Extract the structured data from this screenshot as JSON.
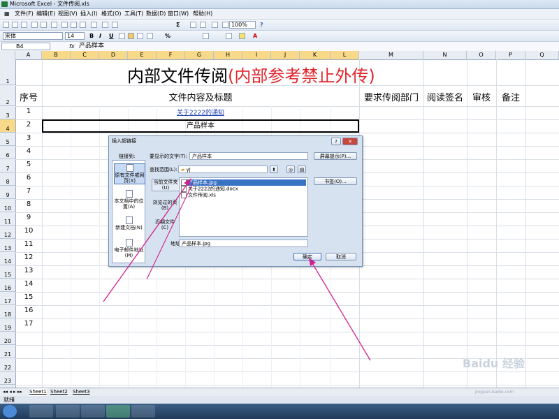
{
  "window": {
    "title": "Microsoft Excel - 文件传阅.xls"
  },
  "menu": [
    "文件(F)",
    "编辑(E)",
    "视图(V)",
    "插入(I)",
    "格式(O)",
    "工具(T)",
    "数据(D)",
    "窗口(W)",
    "帮助(H)"
  ],
  "toolbar": {
    "font": "宋体",
    "size": "14",
    "zoom": "100%",
    "bold": "B",
    "italic": "I",
    "underline": "U"
  },
  "formula": {
    "cell": "B4",
    "fx": "fx",
    "text": "产品样本"
  },
  "columns": [
    "A",
    "B",
    "C",
    "D",
    "E",
    "F",
    "G",
    "H",
    "I",
    "J",
    "K",
    "L",
    "M",
    "N",
    "O",
    "P",
    "Q"
  ],
  "rows": [
    "1",
    "2",
    "3",
    "4",
    "5",
    "6",
    "7",
    "8",
    "9",
    "10",
    "11",
    "12",
    "13",
    "14",
    "15",
    "16",
    "17",
    "18",
    "19",
    "20",
    "21",
    "22",
    "23"
  ],
  "sheet": {
    "title_black": "内部文件传阅",
    "title_red": "(内部参考禁止外传)",
    "headers": {
      "no": "序号",
      "content": "文件内容及标题",
      "dept": "要求传阅部门",
      "sign": "阅读签名",
      "review": "审核",
      "remark": "备注"
    },
    "items": [
      {
        "no": "1",
        "text": "关于2222的通知"
      },
      {
        "no": "2",
        "text": "产品样本"
      },
      {
        "no": "3"
      },
      {
        "no": "4"
      },
      {
        "no": "5"
      },
      {
        "no": "6"
      },
      {
        "no": "7"
      },
      {
        "no": "8"
      },
      {
        "no": "9"
      },
      {
        "no": "10"
      },
      {
        "no": "11"
      },
      {
        "no": "12"
      },
      {
        "no": "13"
      },
      {
        "no": "14"
      },
      {
        "no": "15"
      },
      {
        "no": "16"
      },
      {
        "no": "17"
      }
    ]
  },
  "tabs": [
    "Sheet1",
    "Sheet2",
    "Sheet3"
  ],
  "status": "就绪",
  "watermark": {
    "text1": "Baidu",
    "text2": "经验",
    "url": "jingyan.baidu.com"
  },
  "dialog": {
    "title": "插入超链接",
    "link_to": "链接到:",
    "display_label": "要显示的文字(T):",
    "display_value": "产品样本",
    "screentip": "屏幕提示(P)...",
    "lookin_label": "查找范围(L):",
    "lookin_value": "yj",
    "bookmark": "书签(O)...",
    "address_label": "地址(E):",
    "address_value": "产品样本.jpg",
    "ok": "确定",
    "cancel": "取消",
    "link_options": [
      "原有文件或网页(X)",
      "本文档中的位置(A)",
      "新建文档(N)",
      "电子邮件地址(M)"
    ],
    "look_options": [
      "当前文件夹(U)",
      "浏览过的页(B)",
      "近期文件(C)"
    ],
    "files": [
      "产品样本.jpg",
      "关于2222的通知.docx",
      "文件传阅.xls"
    ]
  },
  "colors": {
    "title_red": "#e0262c",
    "selection": "#3973c5",
    "arrow": "#d21e8c"
  }
}
